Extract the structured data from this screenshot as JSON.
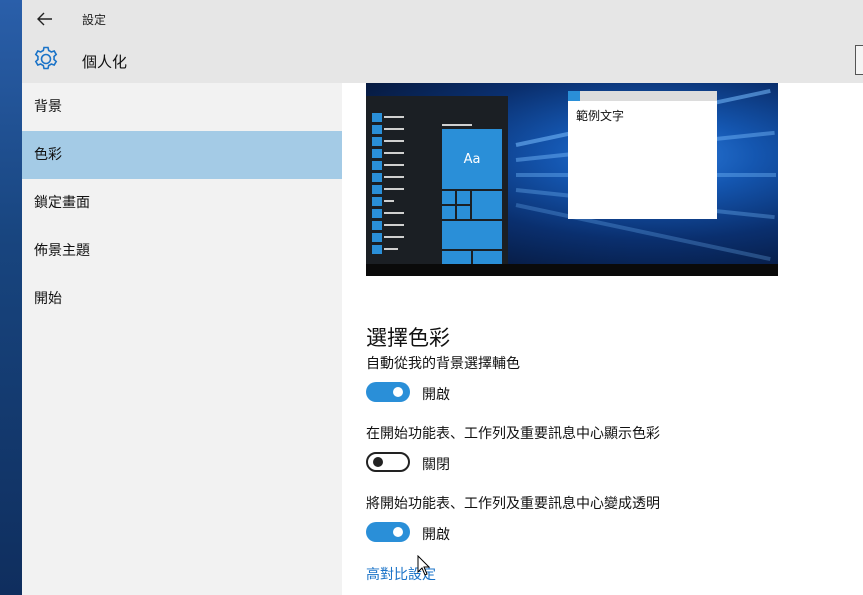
{
  "window": {
    "title": "設定"
  },
  "header": {
    "title": "個人化",
    "icon": "gear-icon"
  },
  "sidebar": {
    "items": [
      {
        "label": "背景",
        "active": false
      },
      {
        "label": "色彩",
        "active": true
      },
      {
        "label": "鎖定畫面",
        "active": false
      },
      {
        "label": "佈景主題",
        "active": false
      },
      {
        "label": "開始",
        "active": false
      }
    ]
  },
  "preview": {
    "tile_label": "Aa",
    "sample_text": "範例文字"
  },
  "main": {
    "section_title": "選擇色彩",
    "settings": [
      {
        "label": "自動從我的背景選擇輔色",
        "state": "開啟",
        "on": true
      },
      {
        "label": "在開始功能表、工作列及重要訊息中心顯示色彩",
        "state": "關閉",
        "on": false
      },
      {
        "label": "將開始功能表、工作列及重要訊息中心變成透明",
        "state": "開啟",
        "on": true
      }
    ],
    "link": "高對比設定"
  },
  "colors": {
    "accent": "#2a8fd8",
    "selected_nav": "#a4cbe6",
    "link": "#1a73c8"
  }
}
